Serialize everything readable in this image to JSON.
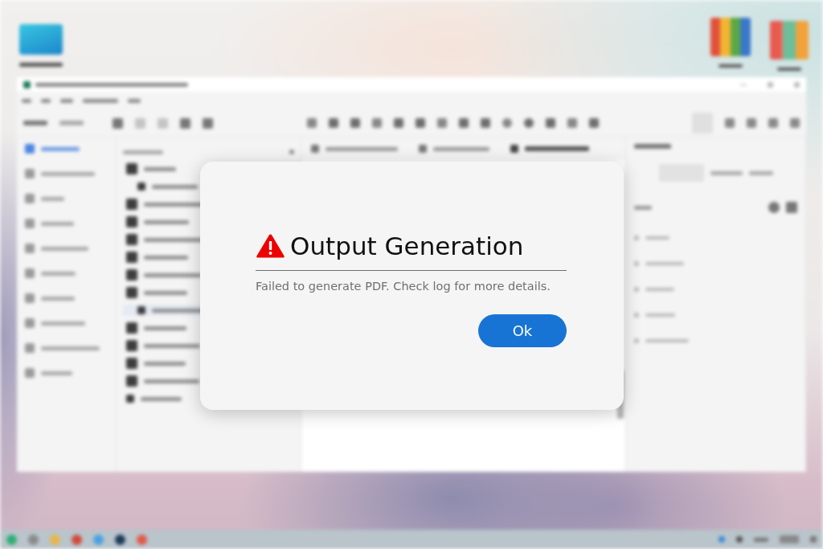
{
  "dialog": {
    "title": "Output Generation",
    "message": "Failed to generate PDF. Check log for more details.",
    "buttons": [
      {
        "label": "Ok"
      }
    ]
  }
}
